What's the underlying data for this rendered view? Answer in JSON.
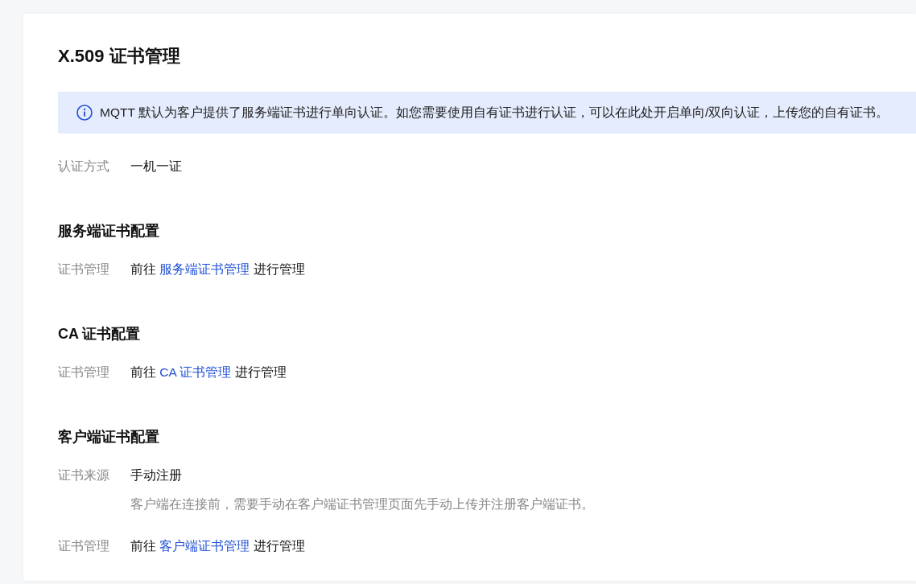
{
  "title": "X.509 证书管理",
  "notice": {
    "text": "MQTT 默认为客户提供了服务端证书进行单向认证。如您需要使用自有证书进行认证，可以在此处开启单向/双向认证，上传您的自有证书。"
  },
  "fields": [
    {
      "kind": "text",
      "label": "认证方式",
      "value": "一机一证"
    }
  ],
  "sections": [
    {
      "title": "服务端证书配置",
      "fields": [
        {
          "kind": "link",
          "label": "证书管理",
          "prefix": "前往",
          "link": "服务端证书管理",
          "suffix": "进行管理"
        }
      ]
    },
    {
      "title": "CA 证书配置",
      "fields": [
        {
          "kind": "link",
          "label": "证书管理",
          "prefix": "前往",
          "link": "CA 证书管理",
          "suffix": "进行管理"
        }
      ]
    },
    {
      "title": "客户端证书配置",
      "fields": [
        {
          "kind": "text",
          "label": "证书来源",
          "value": "手动注册",
          "note": "客户端在连接前，需要手动在客户端证书管理页面先手动上传并注册客户端证书。"
        },
        {
          "kind": "link",
          "label": "证书管理",
          "prefix": "前往",
          "link": "客户端证书管理",
          "suffix": "进行管理"
        }
      ]
    }
  ]
}
